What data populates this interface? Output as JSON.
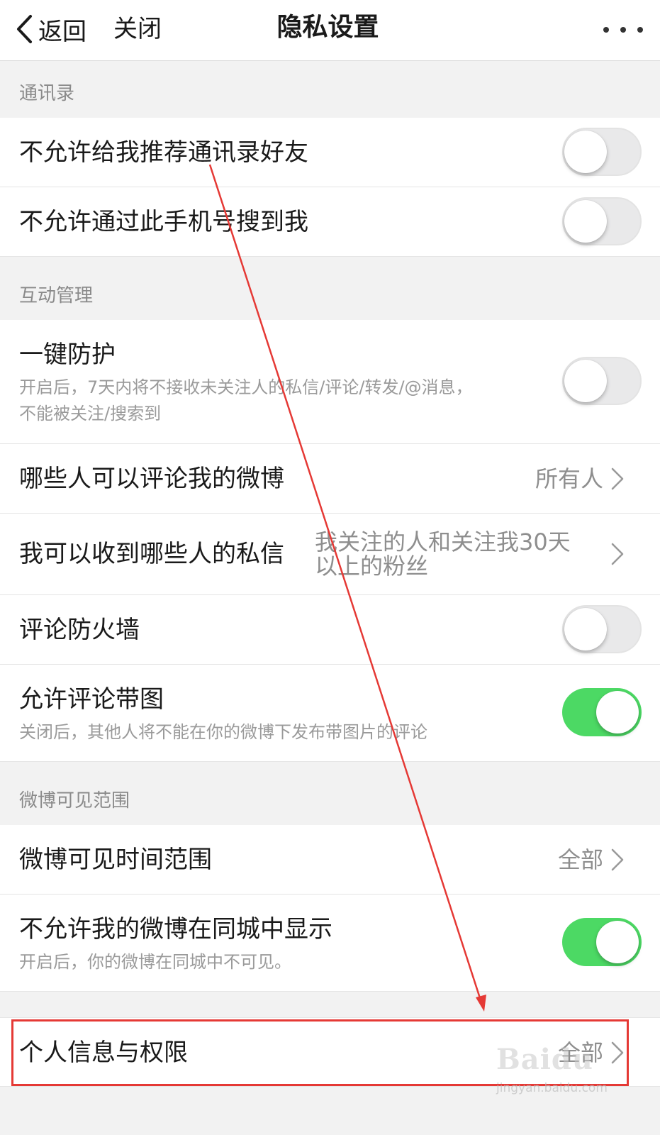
{
  "navbar": {
    "back_label": "返回",
    "close_label": "关闭",
    "title": "隐私设置"
  },
  "sections": {
    "contacts": {
      "header": "通讯录",
      "items": [
        {
          "label": "不允许给我推荐通讯录好友",
          "toggle": "off"
        },
        {
          "label": "不允许通过此手机号搜到我",
          "toggle": "off"
        }
      ]
    },
    "interaction": {
      "header": "互动管理",
      "protect": {
        "label": "一键防护",
        "desc_line1": "开启后，7天内将不接收未关注人的私信/评论/转发/@消息，",
        "desc_line2": "不能被关注/搜索到",
        "toggle": "off"
      },
      "comment_who": {
        "label": "哪些人可以评论我的微博",
        "value": "所有人"
      },
      "message_who": {
        "label": "我可以收到哪些人的私信",
        "value_line1": "我关注的人和关注我30天",
        "value_line2": "以上的粉丝"
      },
      "firewall": {
        "label": "评论防火墙",
        "toggle": "off"
      },
      "comment_image": {
        "label": "允许评论带图",
        "desc": "关闭后，其他人将不能在你的微博下发布带图片的评论",
        "toggle": "on"
      }
    },
    "visibility": {
      "header": "微博可见范围",
      "time_range": {
        "label": "微博可见时间范围",
        "value": "全部"
      },
      "city": {
        "label": "不允许我的微博在同城中显示",
        "desc": "开启后，你的微博在同城中不可见。",
        "toggle": "on"
      }
    },
    "personal": {
      "info": {
        "label": "个人信息与权限",
        "value": "全部"
      }
    }
  },
  "watermark": {
    "brand": "Baidu",
    "site": "jingyan.baidu.com"
  },
  "colors": {
    "toggle_on": "#4cd964",
    "toggle_off": "#e9e9ea",
    "annotation_red": "#e53935",
    "background": "#f2f2f2"
  }
}
